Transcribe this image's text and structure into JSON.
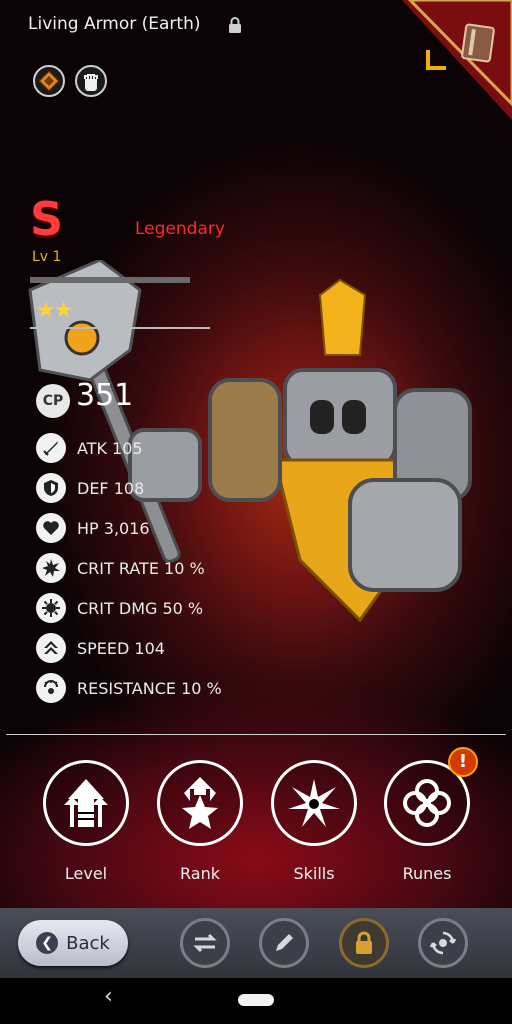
{
  "header": {
    "title": "Living Armor (Earth)",
    "element_icons": [
      "earth-element-icon",
      "fist-type-icon"
    ],
    "corner_icon": "book-icon"
  },
  "monster": {
    "grade": "S",
    "rarity": "Legendary",
    "level": "Lv 1",
    "stars": "★★",
    "star_count": 2,
    "cp_label": "CP",
    "cp_value": "351"
  },
  "stats": [
    {
      "icon": "sword-icon",
      "text": "ATK 105"
    },
    {
      "icon": "shield-icon",
      "text": "DEF 108"
    },
    {
      "icon": "heart-icon",
      "text": "HP 3,016"
    },
    {
      "icon": "crit-rate-icon",
      "text": "CRIT RATE 10 %"
    },
    {
      "icon": "crit-dmg-icon",
      "text": "CRIT DMG 50 %"
    },
    {
      "icon": "speed-icon",
      "text": "SPEED 104"
    },
    {
      "icon": "resistance-icon",
      "text": "RESISTANCE 10 %"
    }
  ],
  "actions": [
    {
      "label": "Level",
      "icon": "level-up-icon"
    },
    {
      "label": "Rank",
      "icon": "rank-star-icon"
    },
    {
      "label": "Skills",
      "icon": "skills-burst-icon"
    },
    {
      "label": "Runes",
      "icon": "runes-icon",
      "alert": "!"
    }
  ],
  "toolbar": {
    "back_label": "Back",
    "tools": [
      "swap-icon",
      "pencil-icon",
      "lock-icon",
      "recycle-icon"
    ]
  },
  "colors": {
    "grade": "#ff3b3b",
    "rarity": "#ff2a2a",
    "level": "#e8b400",
    "stars": "#ffd23a",
    "alert": "#d23a00"
  }
}
